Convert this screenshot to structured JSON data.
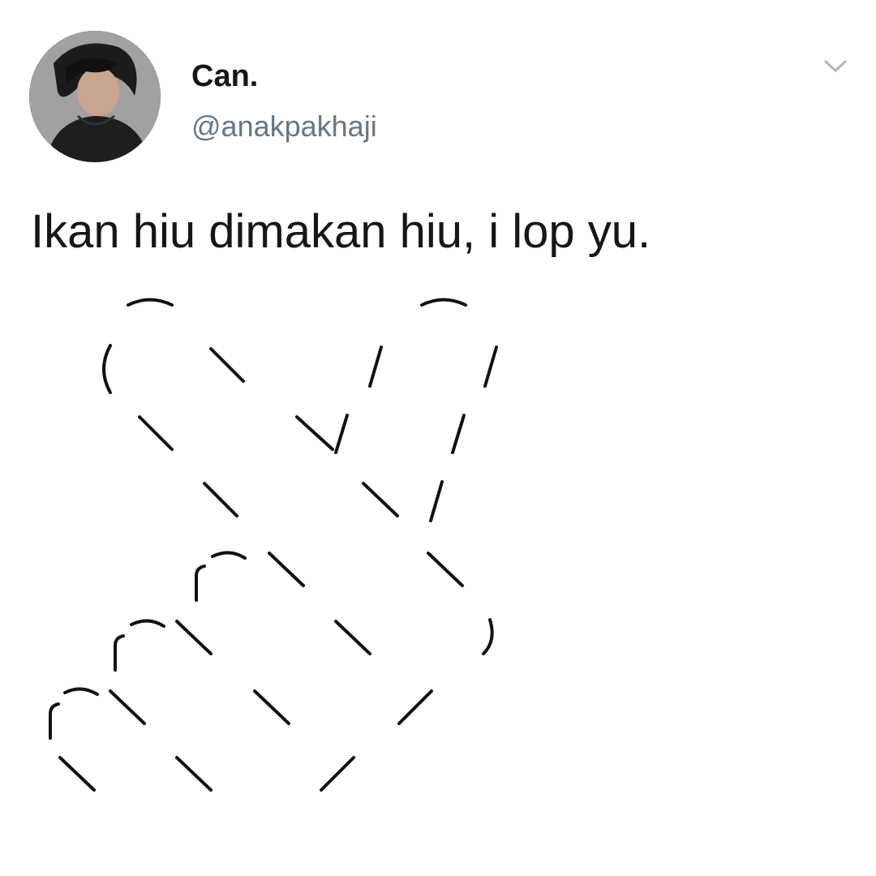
{
  "tweet": {
    "display_name": "Can.",
    "handle": "@anakpakhaji",
    "text": "Ikan hiu dimakan hiu, i lop yu."
  },
  "icons": {
    "avatar": "profile-photo",
    "menu": "chevron-down-icon"
  },
  "colors": {
    "text": "#14171a",
    "handle": "#657786",
    "caret": "#aab8c2",
    "art_stroke": "#111111"
  }
}
